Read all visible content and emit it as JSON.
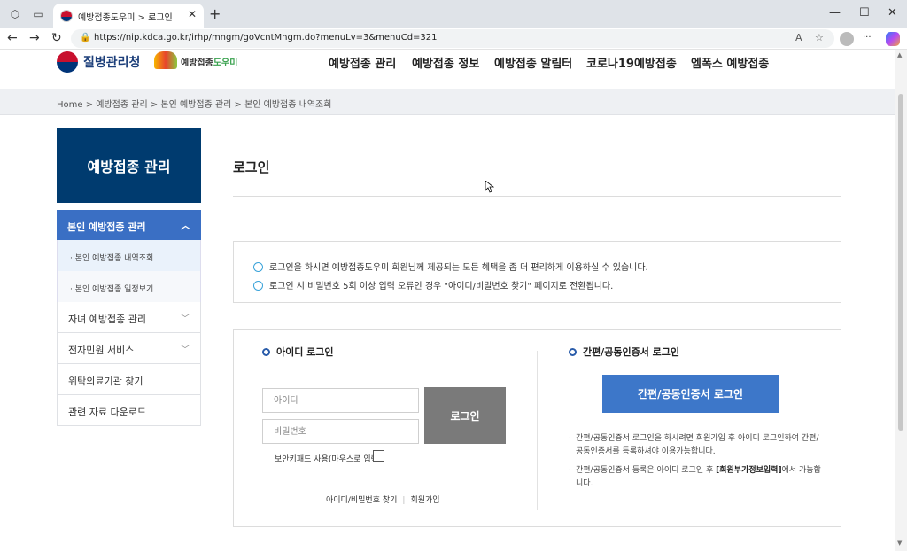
{
  "browser": {
    "tab_title": "예방접종도우미 > 로그인",
    "url": "https://nip.kdca.go.kr/irhp/mngm/goVcntMngm.do?menuLv=3&menuCd=321",
    "new_tab_label": "+",
    "reader_label": "A",
    "more_label": "···"
  },
  "site": {
    "kdca_name": "질병관리청",
    "nip_name_a": "예방접종",
    "nip_name_b": "도우미",
    "nav": [
      "예방접종 관리",
      "예방접종 정보",
      "예방접종 알림터",
      "코로나19예방접종",
      "엠폭스 예방접종"
    ]
  },
  "breadcrumb": "Home  >  예방접종 관리  >  본인 예방접종 관리  >  본인 예방접종 내역조회",
  "sidebar": {
    "title": "예방접종 관리",
    "active": "본인 예방접종 관리",
    "subs": [
      "본인 예방접종 내역조회",
      "본인 예방접종 일정보기"
    ],
    "items": [
      "자녀 예방접종 관리",
      "전자민원 서비스",
      "위탁의료기관 찾기",
      "관련 자료 다운로드"
    ]
  },
  "content": {
    "title": "로그인",
    "notices": [
      "로그인을 하시면 예방접종도우미 회원님께 제공되는 모든 혜택을 좀 더 편리하게 이용하실 수 있습니다.",
      "로그인 시 비밀번호 5회 이상 입력 오류인 경우 \"아이디/비밀번호 찾기\" 페이지로 전환됩니다."
    ],
    "id_login": {
      "heading": "아이디 로그인",
      "id_placeholder": "아이디",
      "pw_placeholder": "비밀번호",
      "login_button": "로그인",
      "keypad_label": "보안키패드 사용(마우스로 입력)",
      "find_link": "아이디/비밀번호 찾기",
      "signup_link": "회원가입"
    },
    "cert_login": {
      "heading": "간편/공동인증서 로그인",
      "button": "간편/공동인증서 로그인",
      "note1": "간편/공동인증서 로그인을 하시려면 회원가입 후 아이디 로그인하여 간편/공동인증서를 등록하셔야 이용가능합니다.",
      "note2_pre": "간편/공동인증서 등록은 아이디 로그인 후 ",
      "note2_bold": "[회원부가정보입력]",
      "note2_post": "에서 가능합니다."
    }
  }
}
